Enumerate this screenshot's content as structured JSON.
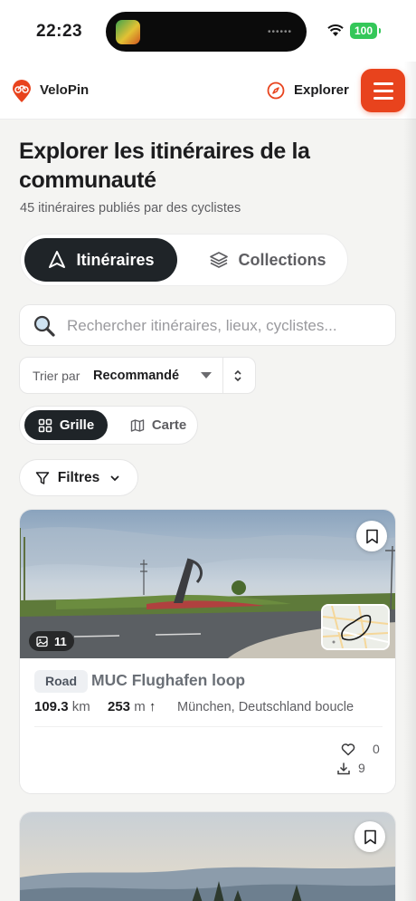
{
  "status_bar": {
    "time": "22:23",
    "battery": "100"
  },
  "nav": {
    "brand": "VeloPin",
    "explore_label": "Explorer",
    "accent_color": "#e8431d"
  },
  "page": {
    "title": "Explorer les itinéraires de la communauté",
    "subtitle": "45 itinéraires publiés par des cyclistes"
  },
  "tabs": [
    {
      "label": "Itinéraires",
      "icon": "navigation-arrow-icon",
      "active": true
    },
    {
      "label": "Collections",
      "icon": "layers-icon",
      "active": false
    }
  ],
  "search": {
    "placeholder": "Rechercher itinéraires, lieux, cyclistes..."
  },
  "sort": {
    "label": "Trier par",
    "value": "Recommandé"
  },
  "view_toggle": {
    "grid_label": "Grille",
    "map_label": "Carte",
    "selected": "Grille"
  },
  "filters": {
    "label": "Filtres"
  },
  "routes": [
    {
      "type": "Road",
      "name": "MUC Flughafen loop",
      "distance": "109.3",
      "distance_unit": "km",
      "elevation": "253",
      "elevation_unit": "m",
      "location": "München, Deutschland boucle",
      "photo_count": "11",
      "likes": "0",
      "downloads": "9"
    }
  ]
}
